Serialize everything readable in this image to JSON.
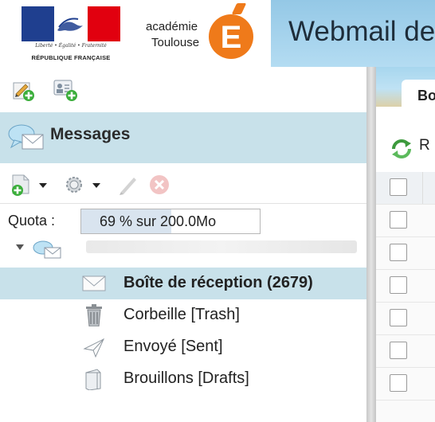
{
  "header": {
    "republic": {
      "motto": "Liberté • Égalité • Fraternité",
      "name": "RÉPUBLIQUE FRANÇAISE"
    },
    "academy": {
      "line1": "académie",
      "line2": "Toulouse",
      "logo_letter": "E"
    },
    "banner_title": "Webmail de"
  },
  "left_panel": {
    "toolbar": {
      "icons": [
        "compose-icon",
        "contact-card-add-icon"
      ]
    },
    "messages": {
      "title": "Messages",
      "icon": "speech-bubble-envelope-icon"
    },
    "folder_toolbar": {
      "icons": [
        "new-folder-icon",
        "dropdown-arrow-icon",
        "gear-icon",
        "dropdown-arrow-icon",
        "pencil-icon",
        "delete-icon"
      ]
    },
    "quota": {
      "label": "Quota :",
      "text": "69 % sur 200.0Mo",
      "used_percent": 69
    },
    "folders": [
      {
        "label": "Boîte de réception (2679)",
        "icon": "envelope-icon",
        "selected": true
      },
      {
        "label": "Corbeille [Trash]",
        "icon": "trash-icon",
        "selected": false
      },
      {
        "label": "Envoyé [Sent]",
        "icon": "paper-plane-icon",
        "selected": false
      },
      {
        "label": "Brouillons [Drafts]",
        "icon": "drafts-icon",
        "selected": false
      }
    ]
  },
  "right_panel": {
    "tab_label": "Bo",
    "refresh_label": "R",
    "row_count": 7
  },
  "colors": {
    "selected_background": "#c8e1ea",
    "banner_background": "#a7d6ee",
    "academy_orange": "#ef7a1a",
    "flag_blue": "#1f3f8f",
    "flag_red": "#e1000f"
  }
}
